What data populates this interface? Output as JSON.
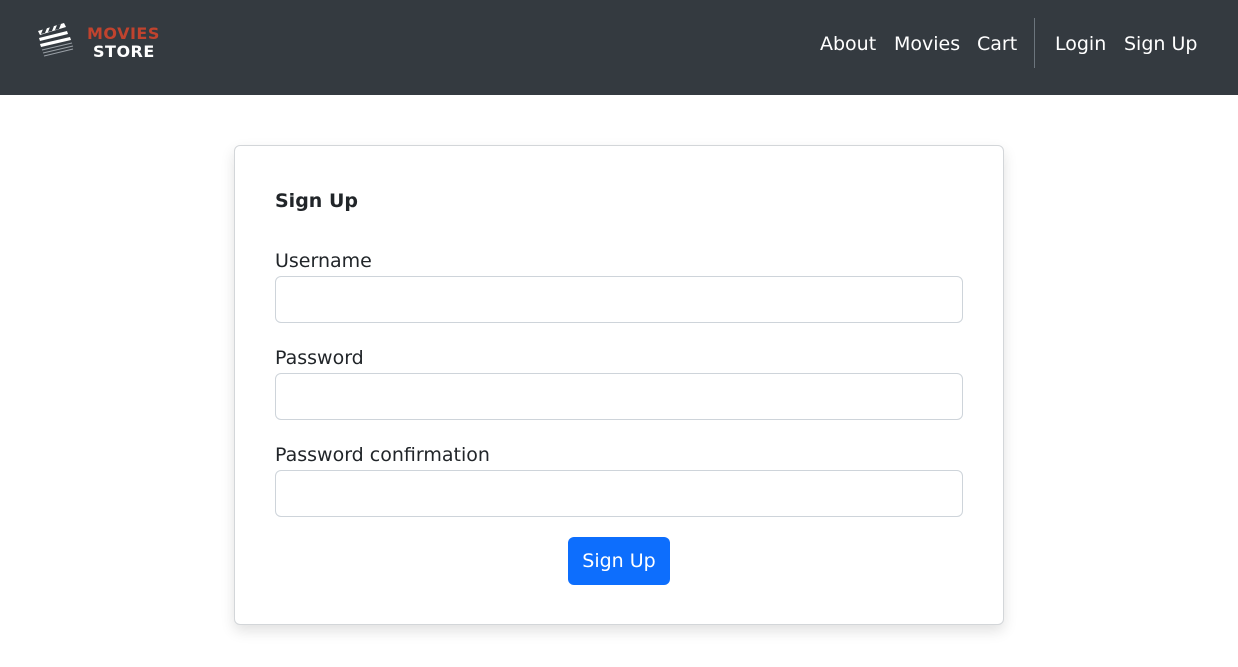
{
  "header": {
    "brand": {
      "line1": "MOVIES",
      "line2": "STORE",
      "icon": "clapperboard-icon",
      "line1_color": "#c0432e",
      "line2_color": "#ffffff"
    },
    "nav": {
      "about": "About",
      "movies": "Movies",
      "cart": "Cart",
      "login": "Login",
      "signup": "Sign Up"
    },
    "background": "#343a40"
  },
  "form": {
    "title": "Sign Up",
    "username_label": "Username",
    "username_value": "",
    "password_label": "Password",
    "password_value": "",
    "password_confirmation_label": "Password confirmation",
    "password_confirmation_value": "",
    "submit_label": "Sign Up",
    "submit_color": "#0d6efd"
  }
}
